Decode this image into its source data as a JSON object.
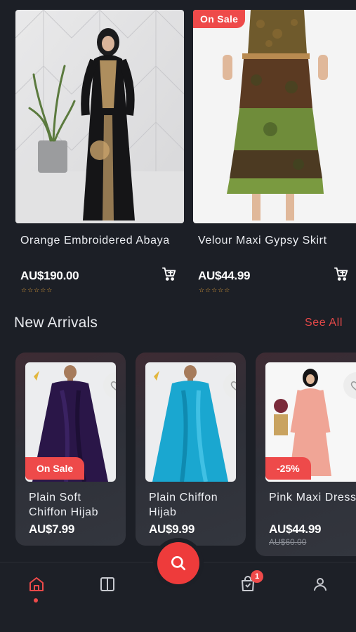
{
  "top_products": [
    {
      "name": "Orange Embroidered Abaya",
      "price": "AU$190.00",
      "rating_stars": "☆☆☆☆☆",
      "sale_label": ""
    },
    {
      "name": "Velour Maxi Gypsy Skirt",
      "price": "AU$44.99",
      "rating_stars": "☆☆☆☆☆",
      "sale_label": "On Sale"
    }
  ],
  "section": {
    "title": "New Arrivals",
    "see_all": "See All"
  },
  "new_arrivals": [
    {
      "name": "Plain Soft Chiffon Hijab",
      "price": "AU$7.99",
      "badge": "On Sale",
      "old_price": ""
    },
    {
      "name": "Plain Chiffon Hijab",
      "price": "AU$9.99",
      "badge": "",
      "old_price": ""
    },
    {
      "name": "Pink  Maxi Dress",
      "price": "AU$44.99",
      "badge": "-25%",
      "old_price": "AU$60.00"
    }
  ],
  "bottom_nav": {
    "items": [
      "home-icon",
      "categories-icon",
      "search-icon",
      "cart-icon",
      "profile-icon"
    ],
    "cart_count": "1",
    "active": "home"
  },
  "colors": {
    "accent": "#ee4a4a",
    "background": "#1c1f26",
    "star": "#e8a43c"
  }
}
